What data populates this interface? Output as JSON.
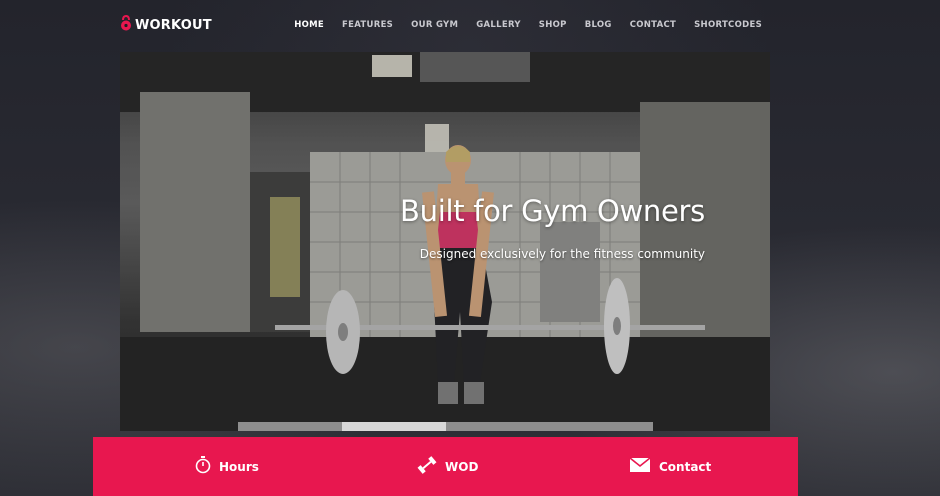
{
  "brand": {
    "name": "WORKOUT",
    "icon": "kettlebell-icon"
  },
  "nav": {
    "items": [
      {
        "label": "HOME",
        "active": true
      },
      {
        "label": "FEATURES",
        "active": false
      },
      {
        "label": "OUR GYM",
        "active": false
      },
      {
        "label": "GALLERY",
        "active": false
      },
      {
        "label": "SHOP",
        "active": false
      },
      {
        "label": "BLOG",
        "active": false
      },
      {
        "label": "CONTACT",
        "active": false
      },
      {
        "label": "SHORTCODES",
        "active": false
      }
    ]
  },
  "hero": {
    "title": "Built for Gym Owners",
    "subtitle": "Designed exclusively for the fitness community",
    "slides": 4,
    "active_slide": 2
  },
  "infobar": {
    "items": [
      {
        "label": "Hours",
        "icon": "stopwatch-icon"
      },
      {
        "label": "WOD",
        "icon": "dumbbell-icon"
      },
      {
        "label": "Contact",
        "icon": "envelope-icon"
      }
    ]
  },
  "colors": {
    "accent": "#e8174f",
    "background": "#23242c",
    "nav_text": "#c9c9cf"
  }
}
